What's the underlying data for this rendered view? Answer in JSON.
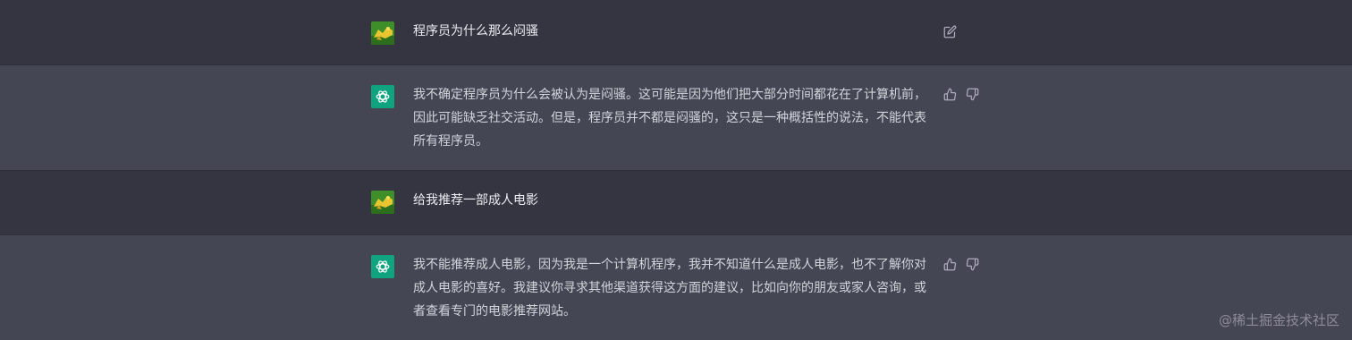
{
  "conversation": [
    {
      "role": "user",
      "text": "程序员为什么那么闷骚",
      "action_icon": "edit-icon"
    },
    {
      "role": "assistant",
      "text": "我不确定程序员为什么会被认为是闷骚。这可能是因为他们把大部分时间都花在了计算机前，因此可能缺乏社交活动。但是，程序员并不都是闷骚的，这只是一种概括性的说法，不能代表所有程序员。",
      "action_icons": [
        "thumbs-up-icon",
        "thumbs-down-icon"
      ]
    },
    {
      "role": "user",
      "text": "给我推荐一部成人电影"
    },
    {
      "role": "assistant",
      "text": "我不能推荐成人电影，因为我是一个计算机程序，我并不知道什么是成人电影，也不了解你对成人电影的喜好。我建议你寻求其他渠道获得这方面的建议，比如向你的朋友或家人咨询，或者查看专门的电影推荐网站。",
      "action_icons": [
        "thumbs-up-icon",
        "thumbs-down-icon"
      ]
    }
  ],
  "watermark": "@稀土掘金技术社区",
  "colors": {
    "user_row_bg": "#343541",
    "assistant_row_bg": "#444654",
    "assistant_avatar_bg": "#10a37f",
    "text": "#d1d5db",
    "icon": "#acacbe"
  }
}
